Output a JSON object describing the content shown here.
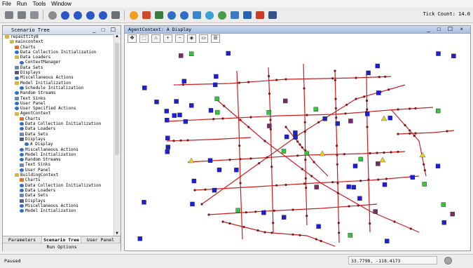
{
  "menu": [
    "File",
    "Run",
    "Tools",
    "Window"
  ],
  "toolbar": {
    "buttons": [
      {
        "name": "save-icon",
        "color": "#7a7f88",
        "shape": "sq"
      },
      {
        "name": "save-as-icon",
        "color": "#7a7f88",
        "shape": "sq"
      },
      {
        "name": "open-icon",
        "color": "#8a8f98",
        "shape": "sq"
      },
      {
        "name": "init-icon",
        "color": "#8c8c8c",
        "shape": "dot"
      },
      {
        "name": "step-icon",
        "color": "#2a56c6",
        "shape": "dot"
      },
      {
        "name": "play-icon",
        "color": "#2a56c6",
        "shape": "dot"
      },
      {
        "name": "stop-icon",
        "color": "#2a56c6",
        "shape": "dot"
      },
      {
        "name": "pause-icon",
        "color": "#2a56c6",
        "shape": "dot"
      },
      {
        "name": "reset-icon",
        "color": "#6a6f76",
        "shape": "sq"
      },
      {
        "name": "orange-icon",
        "color": "#f29b1d",
        "shape": "dot"
      },
      {
        "name": "chart-icon",
        "color": "#d04a2a",
        "shape": "sq"
      },
      {
        "name": "table-icon",
        "color": "#3a7a3a",
        "shape": "sq"
      },
      {
        "name": "globe-icon",
        "color": "#2f6ec7",
        "shape": "dot"
      },
      {
        "name": "globe2-icon",
        "color": "#2f6ec7",
        "shape": "dot"
      },
      {
        "name": "camera-icon",
        "color": "#3a86c8",
        "shape": "sq"
      },
      {
        "name": "world-icon",
        "color": "#3aa0d8",
        "shape": "dot"
      },
      {
        "name": "person-icon",
        "color": "#4a9a4a",
        "shape": "dot"
      },
      {
        "name": "image-icon",
        "color": "#3a7ac8",
        "shape": "sq"
      },
      {
        "name": "grid-icon",
        "color": "#2a62b4",
        "shape": "sq"
      },
      {
        "name": "flag-icon",
        "color": "#cc3a2a",
        "shape": "sq"
      },
      {
        "name": "map-icon",
        "color": "#36508a",
        "shape": "sq"
      }
    ]
  },
  "tick": {
    "label": "Tick Count: 14.0"
  },
  "scenario_tree": {
    "title": "Scenario Tree",
    "controls": "_ □ ☐",
    "nodes": [
      {
        "text": "repasttity8",
        "indent": 0,
        "icon": "folder"
      },
      {
        "text": "maincontext",
        "indent": 1,
        "icon": "folder"
      },
      {
        "text": "Charts",
        "indent": 2,
        "icon": "chart"
      },
      {
        "text": "Data Collection Initialization",
        "indent": 2,
        "icon": "dot"
      },
      {
        "text": "Data Loaders",
        "indent": 2,
        "icon": "folder"
      },
      {
        "text": "ContextManager",
        "indent": 3,
        "icon": "dot"
      },
      {
        "text": "Data Sets",
        "indent": 2,
        "icon": "sheet"
      },
      {
        "text": "Displays",
        "indent": 2,
        "icon": "display"
      },
      {
        "text": "Miscellaneous Actions",
        "indent": 2,
        "icon": "dot"
      },
      {
        "text": "Model Initialization",
        "indent": 2,
        "icon": "folder"
      },
      {
        "text": "Schedule Initialization",
        "indent": 3,
        "icon": "dot"
      },
      {
        "text": "Random Streams",
        "indent": 2,
        "icon": "dot"
      },
      {
        "text": "Text Sinks",
        "indent": 2,
        "icon": "sheet"
      },
      {
        "text": "User Panel",
        "indent": 2,
        "icon": "dot"
      },
      {
        "text": "User Specified Actions",
        "indent": 2,
        "icon": "dot"
      },
      {
        "text": "AgentContext",
        "indent": 2,
        "icon": "folder"
      },
      {
        "text": "Charts",
        "indent": 3,
        "icon": "chart"
      },
      {
        "text": "Data Collection Initialization",
        "indent": 3,
        "icon": "dot"
      },
      {
        "text": "Data Loaders",
        "indent": 3,
        "icon": "dot"
      },
      {
        "text": "Data Sets",
        "indent": 3,
        "icon": "sheet"
      },
      {
        "text": "Displays",
        "indent": 3,
        "icon": "display"
      },
      {
        "text": "A Display",
        "indent": 4,
        "icon": "dot"
      },
      {
        "text": "Miscellaneous Actions",
        "indent": 3,
        "icon": "dot"
      },
      {
        "text": "Model Initialization",
        "indent": 3,
        "icon": "dot"
      },
      {
        "text": "Random Streams",
        "indent": 3,
        "icon": "dot"
      },
      {
        "text": "Text Sinks",
        "indent": 3,
        "icon": "sheet"
      },
      {
        "text": "User Panel",
        "indent": 3,
        "icon": "dot"
      },
      {
        "text": "BuildingContext",
        "indent": 2,
        "icon": "folder"
      },
      {
        "text": "Charts",
        "indent": 3,
        "icon": "chart"
      },
      {
        "text": "Data Collection Initialization",
        "indent": 3,
        "icon": "dot"
      },
      {
        "text": "Data Loaders",
        "indent": 3,
        "icon": "dot"
      },
      {
        "text": "Data Sets",
        "indent": 3,
        "icon": "sheet"
      },
      {
        "text": "Displays",
        "indent": 3,
        "icon": "display"
      },
      {
        "text": "Miscellaneous Actions",
        "indent": 3,
        "icon": "dot"
      },
      {
        "text": "Model Initialization",
        "indent": 3,
        "icon": "dot"
      }
    ],
    "tabs": [
      "Parameters",
      "Scenario Tree",
      "User Panel"
    ],
    "active_tab": "Scenario Tree",
    "run_options": "Run Options"
  },
  "display": {
    "title": "AgentContext: A Display",
    "controls": "_ □ ☐ ×",
    "tools": [
      "pan-icon",
      "select-icon",
      "home-icon",
      "zoom-in-icon",
      "zoom-out-icon",
      "fit-icon",
      "measure-icon",
      "layers-icon"
    ],
    "colors": {
      "road": "#cc1c1c",
      "agent_blue": "#1e1ed8",
      "agent_green": "#35c43a",
      "agent_purple": "#7a2a6a",
      "building": "#7a1818",
      "triangle": "#e6d21a"
    }
  },
  "status": {
    "state": "Paused",
    "coords": "33.7798, -118.4173"
  }
}
